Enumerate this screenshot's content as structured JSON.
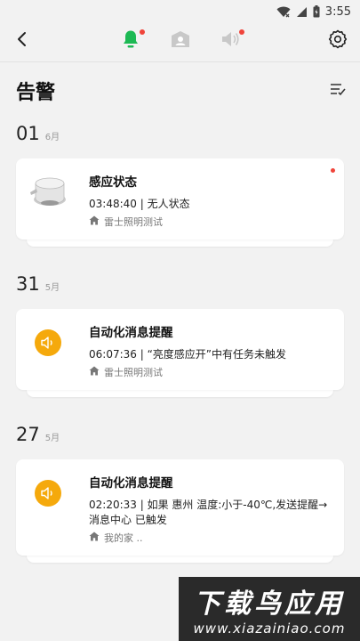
{
  "status_bar": {
    "time": "3:55"
  },
  "nav": {
    "tabs": [
      {
        "name": "alerts",
        "active": true,
        "unread": true
      },
      {
        "name": "contacts",
        "active": false,
        "unread": false
      },
      {
        "name": "broadcast",
        "active": false,
        "unread": true
      }
    ]
  },
  "header": {
    "title": "告警"
  },
  "colors": {
    "active_tab": "#1db954",
    "inactive_tab": "#c8c8c8",
    "accent": "#f5a90c",
    "unread": "#f0443a"
  },
  "sections": [
    {
      "day": "01",
      "month": "6月",
      "card": {
        "icon": "sensor-device-icon",
        "title": "感应状态",
        "desc": "03:48:40 | 无人状态",
        "home": "雷士照明测试",
        "unread": true
      }
    },
    {
      "day": "31",
      "month": "5月",
      "card": {
        "icon": "speaker-icon",
        "title": "自动化消息提醒",
        "desc": "06:07:36 | “亮度感应开”中有任务未触发",
        "home": "雷士照明测试",
        "unread": false
      }
    },
    {
      "day": "27",
      "month": "5月",
      "card": {
        "icon": "speaker-icon",
        "title": "自动化消息提醒",
        "desc": "02:20:33 | 如果 惠州 温度:小于-40℃,发送提醒→消息中心 已触发",
        "home": "我的家 ..",
        "unread": false
      }
    }
  ],
  "watermark": {
    "big": "下载鸟应用",
    "small": "www.xiazainiao.com"
  }
}
